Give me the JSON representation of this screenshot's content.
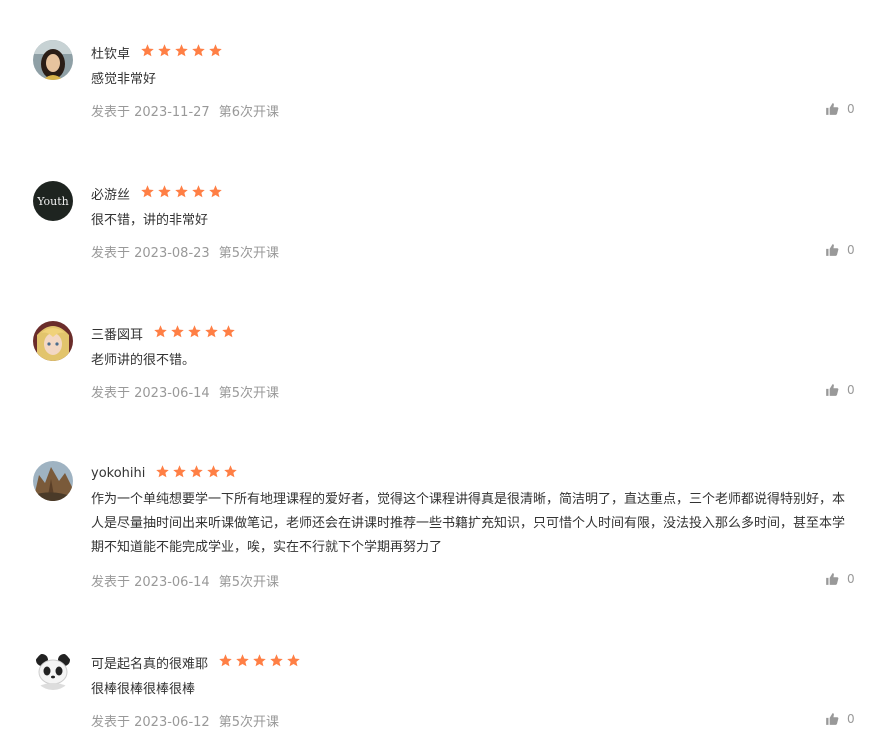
{
  "comments": [
    {
      "username": "杜钦卓",
      "rating": 5,
      "content": "感觉非常好",
      "date_prefix": "发表于 2023-11-27",
      "session": "第6次开课",
      "likes": "0",
      "avatar_icon": "portrait-avatar"
    },
    {
      "username": "必游丝",
      "rating": 5,
      "content": "很不错，讲的非常好",
      "date_prefix": "发表于 2023-08-23",
      "session": "第5次开课",
      "likes": "0",
      "avatar_icon": "youth-text-avatar",
      "avatar_text": "Youth"
    },
    {
      "username": "三番図耳",
      "rating": 5,
      "content": "老师讲的很不错。",
      "date_prefix": "发表于 2023-06-14",
      "session": "第5次开课",
      "likes": "0",
      "avatar_icon": "anime-portrait-avatar"
    },
    {
      "username": "yokohihi",
      "rating": 5,
      "content": "作为一个单纯想要学一下所有地理课程的爱好者，觉得这个课程讲得真是很清晰，简洁明了，直达重点，三个老师都说得特别好，本人是尽量抽时间出来听课做笔记，老师还会在讲课时推荐一些书籍扩充知识，只可惜个人时间有限，没法投入那么多时间，甚至本学期不知道能不能完成学业，唉，实在不行就下个学期再努力了",
      "date_prefix": "发表于 2023-06-14",
      "session": "第5次开课",
      "likes": "0",
      "avatar_icon": "landscape-avatar"
    },
    {
      "username": "可是起名真的很难耶",
      "rating": 5,
      "content": "很棒很棒很棒很棒",
      "date_prefix": "发表于 2023-06-12",
      "session": "第5次开课",
      "likes": "0",
      "avatar_icon": "panda-avatar"
    }
  ],
  "colors": {
    "star": "#ff7f45",
    "meta": "#999999",
    "text": "#333333"
  }
}
